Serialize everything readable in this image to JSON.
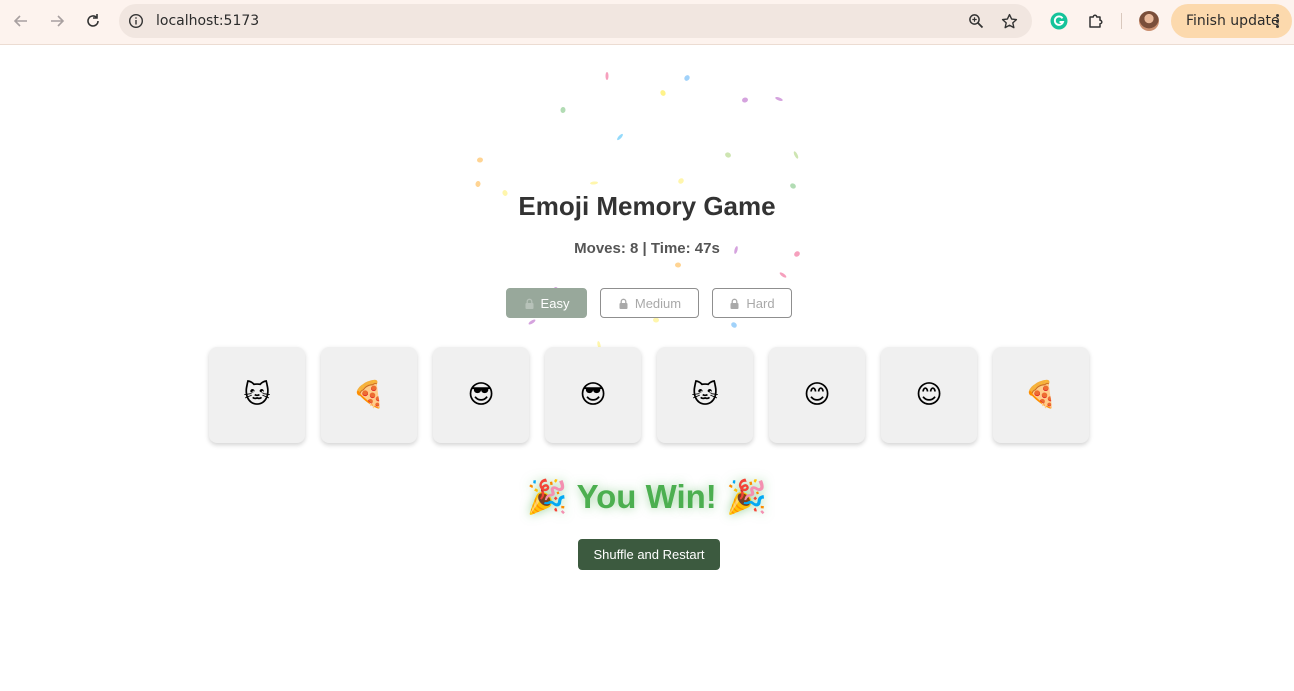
{
  "browser": {
    "url": "localhost:5173",
    "update_label": "Finish update"
  },
  "game": {
    "title": "Emoji Memory Game",
    "stats": "Moves: 8 | Time: 47s",
    "difficulty": [
      {
        "label": "Easy",
        "state": "active"
      },
      {
        "label": "Medium",
        "state": "locked"
      },
      {
        "label": "Hard",
        "state": "locked"
      }
    ],
    "cards": [
      "🐱",
      "🍕",
      "😎",
      "😎",
      "🐱",
      "😊",
      "😊",
      "🍕"
    ],
    "win_message": "🎉 You Win! 🎉",
    "restart_label": "Shuffle and Restart"
  },
  "colors": {
    "accent_green": "#4caf50",
    "button_dark_green": "#3c5a3f",
    "easy_active": "#98a89b"
  }
}
